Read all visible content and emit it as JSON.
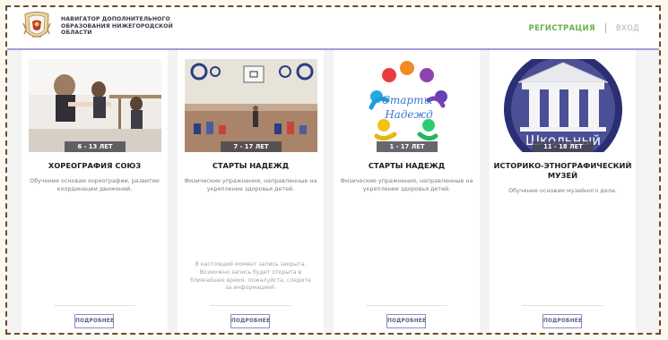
{
  "header": {
    "site_title": "НАВИГАТОР ДОПОЛНИТЕЛЬНОГО ОБРАЗОВАНИЯ НИЖЕГОРОДСКОЙ ОБЛАСТИ",
    "register_label": "РЕГИСТРАЦИЯ",
    "login_label": "ВХОД"
  },
  "cards": [
    {
      "title": "ХОРЕОГРАФИЯ СОЮЗ",
      "age": "6 - 13 ЛЕТ",
      "description": "Обучение основам хореографии, развитие координации движений.",
      "more_label": "ПОДРОБНЕЕ"
    },
    {
      "title": "СТАРТЫ НАДЕЖД",
      "age": "7 - 17 ЛЕТ",
      "description": "Физические упражнения, направленные на укрепление здоровья детей.",
      "closed_note": "В настоящий момент запись закрыта. Возможно запись будет открыта в ближайшее время, пожалуйста, следите за информацией.",
      "more_label": "ПОДРОБНЕЕ"
    },
    {
      "title": "СТАРТЫ НАДЕЖД",
      "age": "1 - 17 ЛЕТ",
      "image_text_1": "Старты",
      "image_text_2": "Надежд",
      "description": "Физические упражнения, направленные на укрепление здоровья детей.",
      "more_label": "ПОДРОБНЕЕ"
    },
    {
      "title": "ИСТОРИКО-ЭТНОГРАФИЧЕСКИЙ МУЗЕЙ",
      "age": "11 - 18 ЛЕТ",
      "image_text": "Школьный",
      "description": "Обучение основам музейного дела.",
      "more_label": "ПОДРОБНЕЕ"
    }
  ],
  "colors": {
    "accent_green": "#6ab04c",
    "header_line": "#a99ad6",
    "button_border": "#8c8fbc"
  }
}
